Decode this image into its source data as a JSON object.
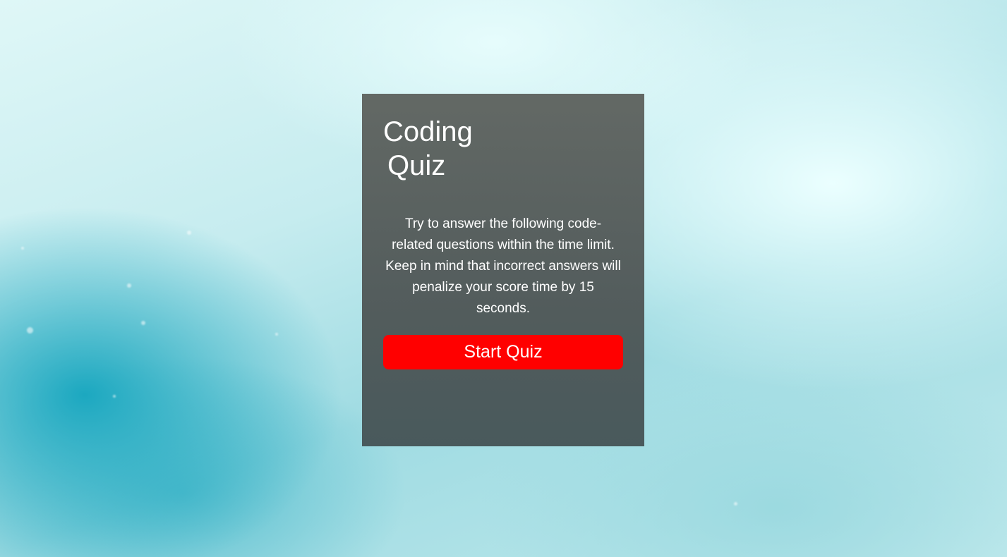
{
  "quiz": {
    "title_line1": "Coding",
    "title_line2": "Quiz",
    "description": "Try to answer the following code-related questions within the time limit. Keep in mind that incorrect answers will penalize your score time by 15 seconds.",
    "start_button_label": "Start Quiz"
  },
  "colors": {
    "start_button": "#ff0000",
    "card_overlay": "#5a605e",
    "text": "#ffffff"
  }
}
